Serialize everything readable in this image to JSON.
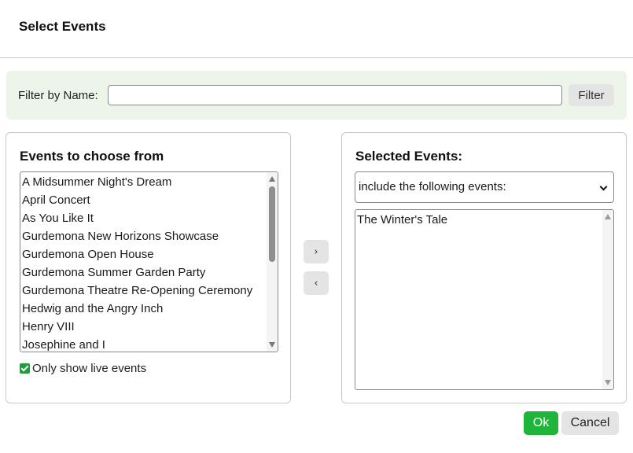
{
  "dialog": {
    "title": "Select Events"
  },
  "filter": {
    "label": "Filter by Name:",
    "value": "",
    "button_label": "Filter"
  },
  "left_panel": {
    "heading": "Events to choose from",
    "items": [
      "A Midsummer Night's Dream",
      "April Concert",
      "As You Like It",
      "Gurdemona New Horizons Showcase",
      "Gurdemona Open House",
      "Gurdemona Summer Garden Party",
      "Gurdemona Theatre Re-Opening Ceremony",
      "Hedwig and the Angry Inch",
      "Henry VIII",
      "Josephine and I"
    ],
    "live_only_label": "Only show live events",
    "live_only_checked": true
  },
  "move_buttons": {
    "add_icon": "chevron-right-icon",
    "add_glyph": "›",
    "remove_icon": "chevron-left-icon",
    "remove_glyph": "‹"
  },
  "right_panel": {
    "heading": "Selected Events:",
    "mode_selected": "include the following events:",
    "items": [
      "The Winter's Tale"
    ]
  },
  "footer": {
    "ok_label": "Ok",
    "cancel_label": "Cancel"
  },
  "colors": {
    "accent": "#1fb53a",
    "filter_background": "#edf5ea",
    "checkbox": "#1f9d3c"
  }
}
